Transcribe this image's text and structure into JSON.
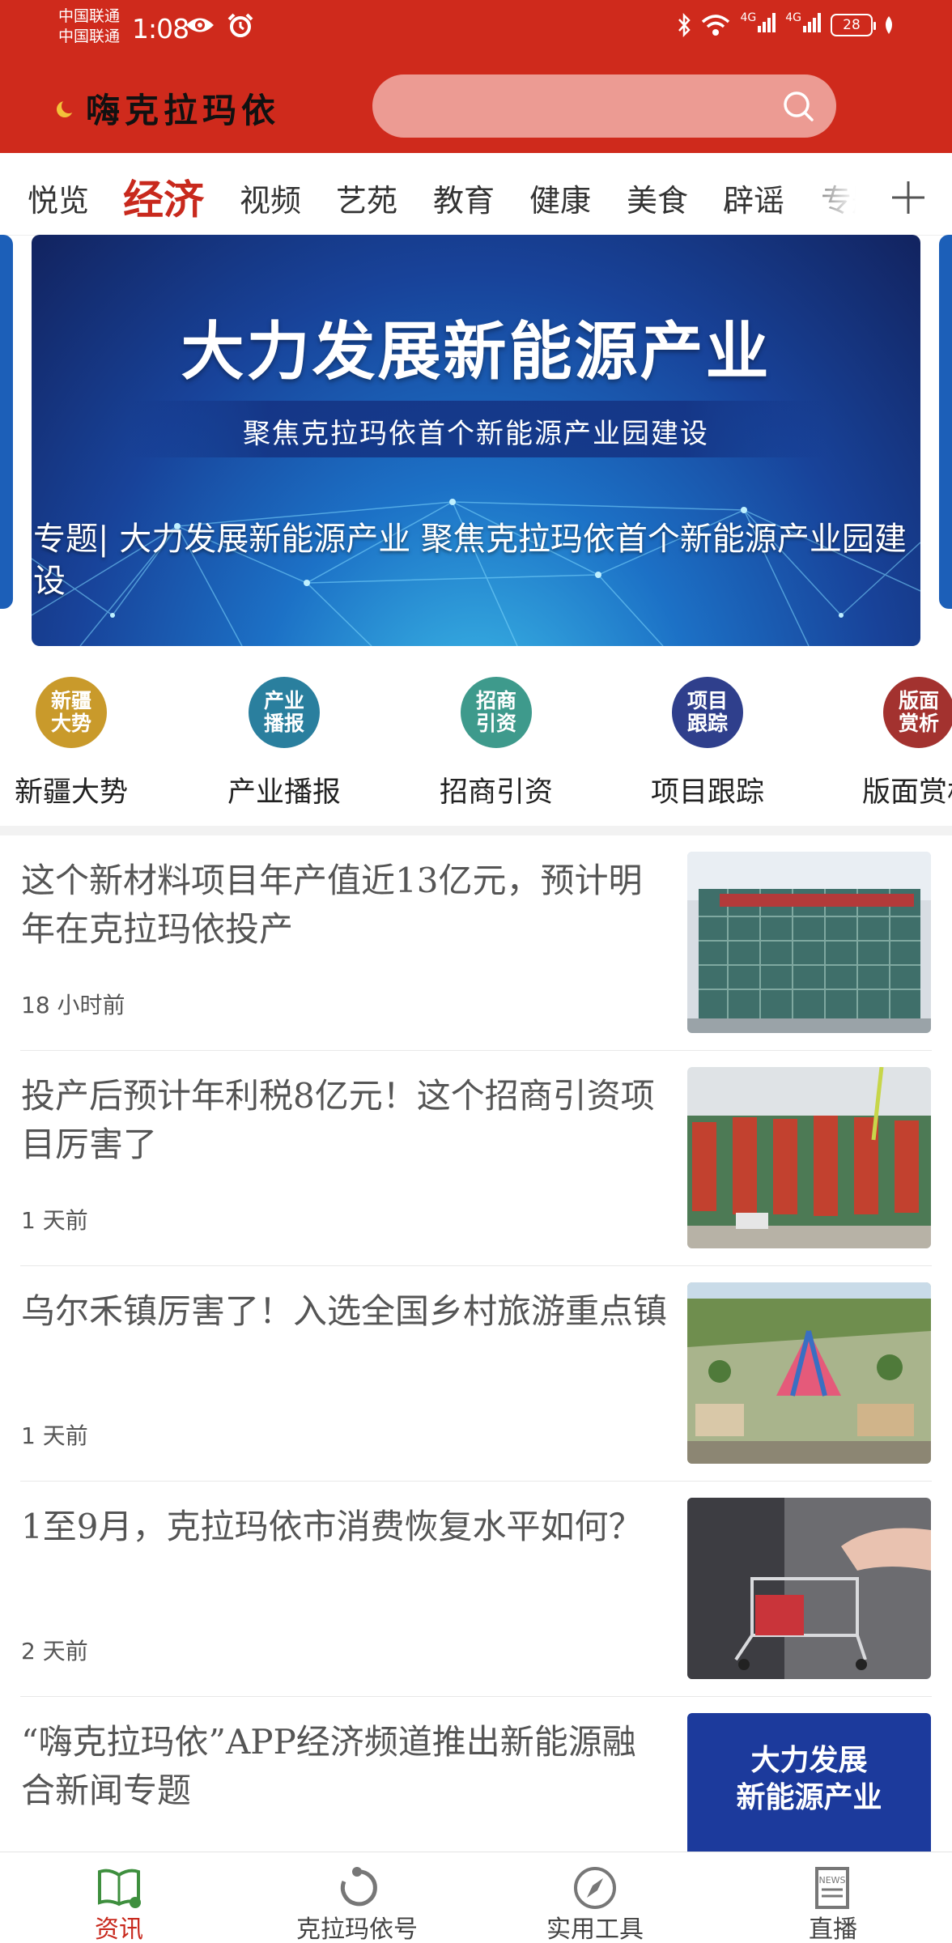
{
  "status_bar": {
    "carrier_1": "中国联通",
    "carrier_2": "中国联通",
    "time": "1:08",
    "network_1": "4G",
    "network_2": "4G",
    "battery": "28"
  },
  "header": {
    "brand_name": "嗨克拉玛依",
    "search_icon": "search-icon",
    "accent_color": "#cf2a1c"
  },
  "tabs": [
    {
      "label": "悦览",
      "active": false
    },
    {
      "label": "经济",
      "active": true
    },
    {
      "label": "视频",
      "active": false
    },
    {
      "label": "艺苑",
      "active": false
    },
    {
      "label": "教育",
      "active": false
    },
    {
      "label": "健康",
      "active": false
    },
    {
      "label": "美食",
      "active": false
    },
    {
      "label": "辟谣",
      "active": false
    },
    {
      "label": "专题",
      "active": false
    }
  ],
  "banner": {
    "title": "大力发展新能源产业",
    "subtitle": "聚焦克拉玛依首个新能源产业园建设",
    "caption": "专题| 大力发展新能源产业 聚焦克拉玛依首个新能源产业园建设"
  },
  "shortcuts": [
    {
      "icon_text_1": "新疆",
      "icon_text_2": "大势",
      "label": "新疆大势",
      "color": "#c99a2b"
    },
    {
      "icon_text_1": "产业",
      "icon_text_2": "播报",
      "label": "产业播报",
      "color": "#2a7f9e"
    },
    {
      "icon_text_1": "招商",
      "icon_text_2": "引资",
      "label": "招商引资",
      "color": "#3e9a8c"
    },
    {
      "icon_text_1": "项目",
      "icon_text_2": "跟踪",
      "label": "项目跟踪",
      "color": "#2f3f8c"
    },
    {
      "icon_text_1": "版面",
      "icon_text_2": "赏析",
      "label": "版面赏析",
      "color": "#a3322f"
    }
  ],
  "news": [
    {
      "title": "这个新材料项目年产值近13亿元，预计明年在克拉玛依投产",
      "time": "18 小时前",
      "thumb": "building-under-construction"
    },
    {
      "title": "投产后预计年利税8亿元！这个招商引资项目厉害了",
      "time": "1 天前",
      "thumb": "construction-site"
    },
    {
      "title": "乌尔禾镇厉害了！入选全国乡村旅游重点镇",
      "time": "1 天前",
      "thumb": "aerial-town"
    },
    {
      "title": "1至9月，克拉玛依市消费恢复水平如何？",
      "time": "2 天前",
      "thumb": "shopping-cart"
    },
    {
      "title": "“嗨克拉玛依”APP经济频道推出新能源融合新闻专题",
      "time": "",
      "thumb": "banner-thumb",
      "thumb_text_1": "大力发展",
      "thumb_text_2": "新能源产业"
    }
  ],
  "bottom_nav": [
    {
      "label": "资讯",
      "icon": "book-icon",
      "active": true
    },
    {
      "label": "克拉玛依号",
      "icon": "refresh-icon",
      "active": false
    },
    {
      "label": "实用工具",
      "icon": "compass-icon",
      "active": false
    },
    {
      "label": "直播",
      "icon": "news-icon",
      "icon_text": "NEWS",
      "active": false
    }
  ]
}
